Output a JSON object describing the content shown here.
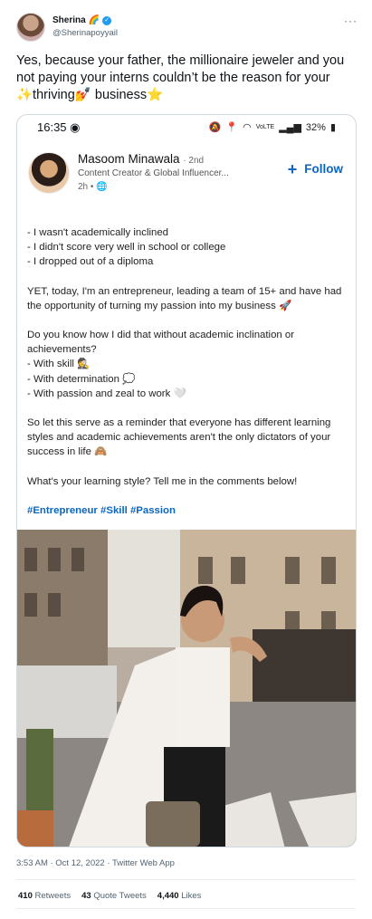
{
  "tweet": {
    "name": "Sherina",
    "handle": "@Sherinapoyyail",
    "text": "Yes, because your father, the millionaire jeweler and you not paying your interns couldn’t be the reason for your ✨thriving💅 business⭐",
    "timestamp": "3:53 AM · Oct 12, 2022 · Twitter Web App",
    "retweets": "410",
    "retweets_label": "Retweets",
    "quotes": "43",
    "quotes_label": "Quote Tweets",
    "likes": "4,440",
    "likes_label": "Likes"
  },
  "phone": {
    "time": "16:35",
    "battery": "32%",
    "signal": "VoLTE"
  },
  "post": {
    "author": "Masoom Minawala",
    "degree": "· 2nd",
    "headline": "Content Creator & Global Influencer...",
    "age": "2h •",
    "follow": "Follow",
    "lines": [
      "- I wasn't academically inclined",
      "- I didn't score very well in school or college",
      "- I dropped out of a diploma",
      "",
      "YET, today, I'm an entrepreneur, leading a team of 15+ and have had the opportunity of turning my passion into my business 🚀",
      "",
      "Do you know how I did that without academic inclination or achievements?",
      "- With skill 🕵",
      "- With determination 💭",
      "- With passion and zeal to work 🤍",
      "",
      "So let this serve as a reminder that everyone has different learning styles and academic achievements aren't the only dictators of your success in life 🙈",
      "",
      "What's your learning style? Tell me in the comments below!"
    ],
    "hashtags": "#Entrepreneur #Skill #Passion"
  }
}
